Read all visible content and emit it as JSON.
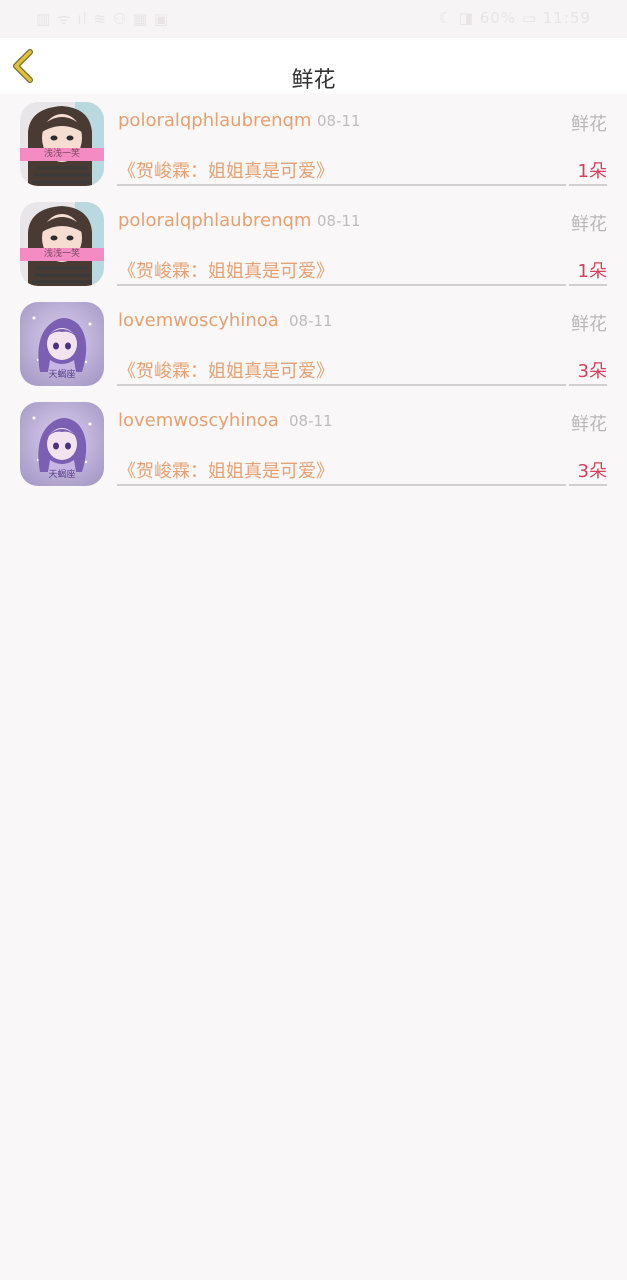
{
  "status_bar": {
    "left": "▥ ᯤ ıl ≋ ⚇ ▦ ▣",
    "right": "☾ ◨ 60% ▭ 11:59"
  },
  "header": {
    "title": "鲜花"
  },
  "records": [
    {
      "username": "poloralqphlaubrenqm",
      "date": "08-11",
      "gift_type": "鲜花",
      "article": "《贺峻霖：姐姐真是可爱》",
      "count": "1朵",
      "avatar_caption": "浅浅一笑"
    },
    {
      "username": "poloralqphlaubrenqm",
      "date": "08-11",
      "gift_type": "鲜花",
      "article": "《贺峻霖：姐姐真是可爱》",
      "count": "1朵",
      "avatar_caption": "浅浅一笑"
    },
    {
      "username": "lovemwoscyhinoa",
      "date": "08-11",
      "gift_type": "鲜花",
      "article": "《贺峻霖：姐姐真是可爱》",
      "count": "3朵",
      "avatar_caption": "天蝎座"
    },
    {
      "username": "lovemwoscyhinoa",
      "date": "08-11",
      "gift_type": "鲜花",
      "article": "《贺峻霖：姐姐真是可爱》",
      "count": "3朵",
      "avatar_caption": "天蝎座"
    }
  ],
  "colors": {
    "accent_orange": "#e8a070",
    "count_red": "#d8405a",
    "back_icon_yellow": "#e0c23a"
  },
  "icons": {
    "back": "chevron-left-icon"
  }
}
